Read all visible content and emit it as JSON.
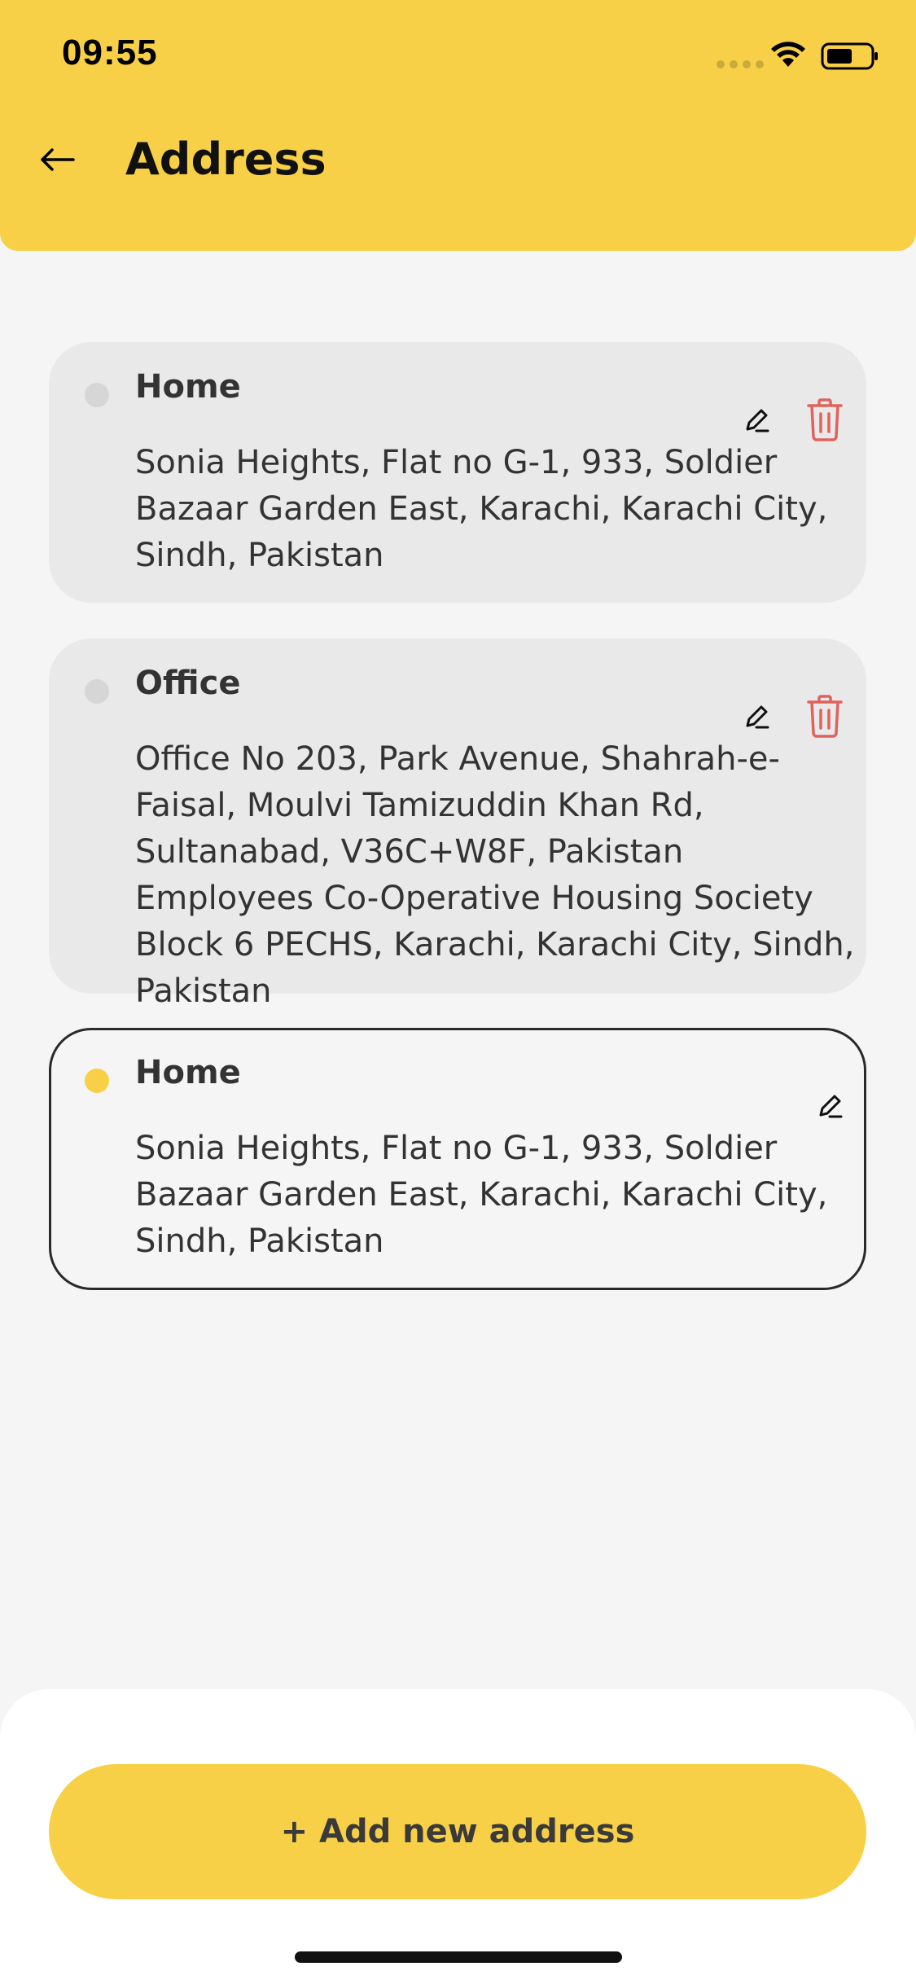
{
  "status_bar": {
    "time": "09:55"
  },
  "header": {
    "title": "Address",
    "back_icon": "arrow-left-icon"
  },
  "addresses": [
    {
      "label": "Home",
      "address": "Sonia Heights, Flat no G-1, 933, Soldier Bazaar Garden East, Karachi, Karachi City, Sindh, Pakistan",
      "selected": false,
      "editable": true,
      "deletable": true
    },
    {
      "label": "Office",
      "address": "Office No 203, Park Avenue, Shahrah-e-Faisal, Moulvi Tamizuddin Khan Rd, Sultanabad, V36C+W8F, Pakistan Employees Co-Operative Housing Society Block 6 PECHS, Karachi, Karachi City, Sindh, Pakistan",
      "selected": false,
      "editable": true,
      "deletable": true
    },
    {
      "label": "Home",
      "address": "Sonia Heights, Flat no G-1, 933, Soldier Bazaar Garden East, Karachi, Karachi City, Sindh, Pakistan",
      "selected": true,
      "editable": true,
      "deletable": false
    }
  ],
  "footer": {
    "add_button_label": "+ Add new address"
  },
  "colors": {
    "accent": "#f8d047",
    "delete": "#e0625c",
    "card": "#e9e9e9",
    "background": "#f5f5f5"
  }
}
